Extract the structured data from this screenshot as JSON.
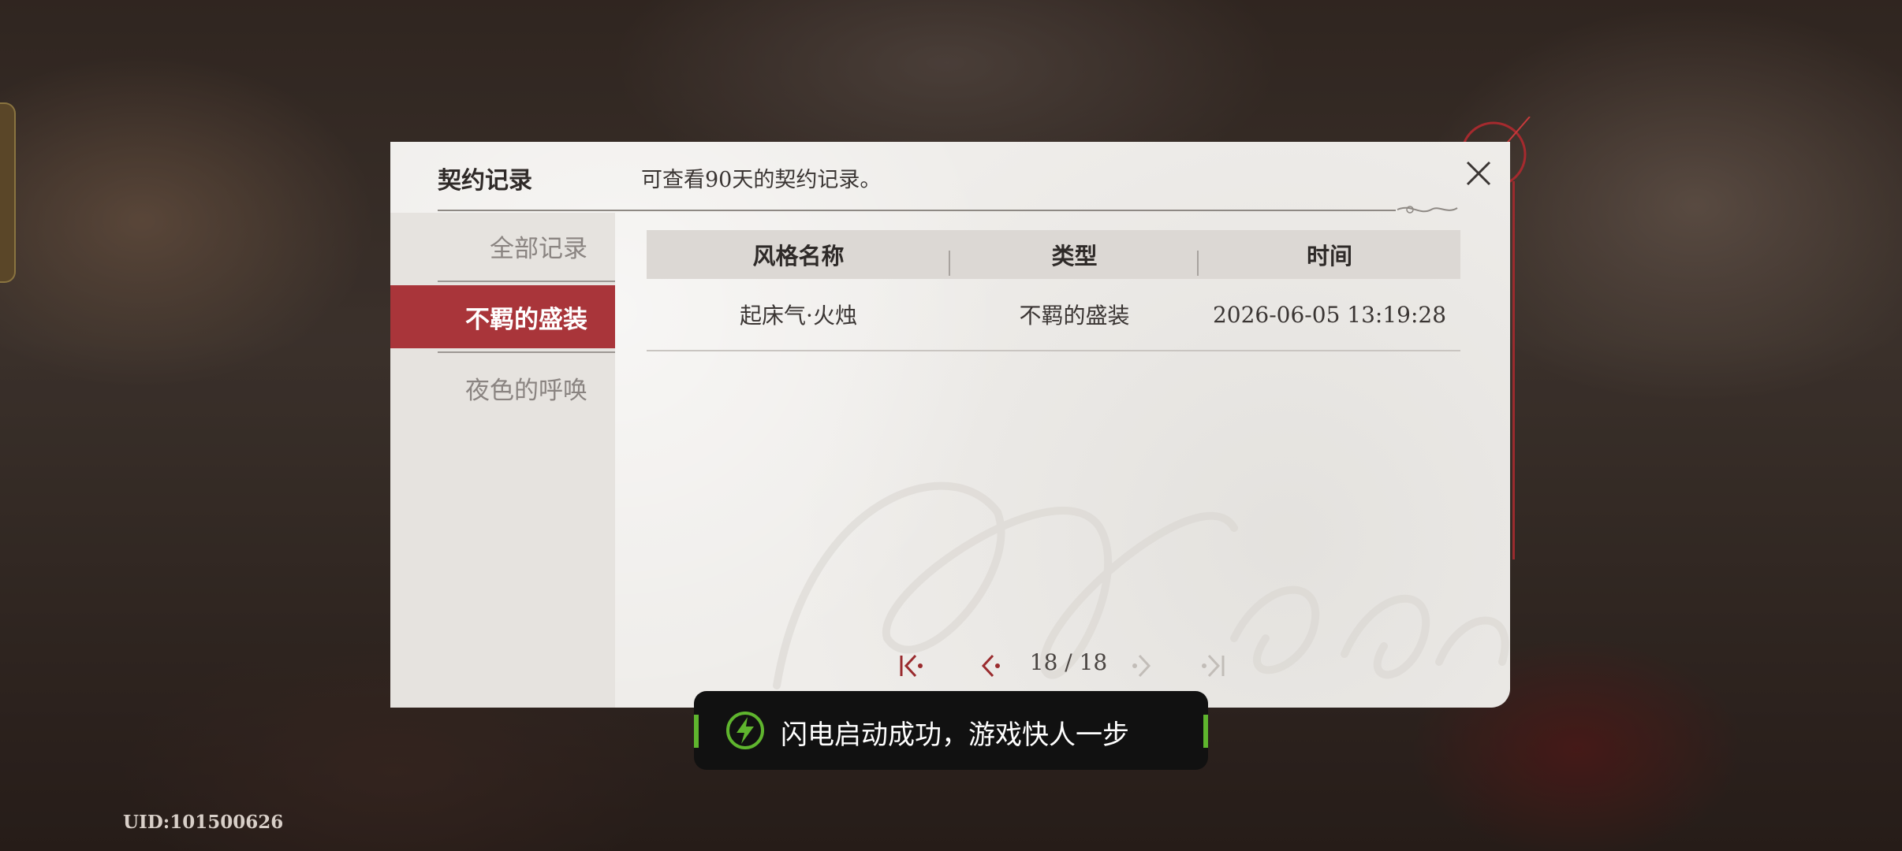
{
  "header": {
    "title": "契约记录",
    "subtitle": "可查看90天的契约记录。"
  },
  "sidebar": {
    "items": [
      {
        "label": "全部记录",
        "active": false
      },
      {
        "label": "不羁的盛装",
        "active": true
      },
      {
        "label": "夜色的呼唤",
        "active": false
      }
    ]
  },
  "table": {
    "columns": [
      "风格名称",
      "类型",
      "时间"
    ],
    "rows": [
      {
        "name": "起床气·火烛",
        "type": "不羁的盛装",
        "time": "2026-06-05 13:19:28"
      }
    ]
  },
  "pagination": {
    "current": "18",
    "total": "18",
    "label": "18 / 18"
  },
  "toast": {
    "text": "闪电启动成功，游戏快人一步"
  },
  "uid": "UID:101500626",
  "colors": {
    "accent_red": "#a9353a",
    "toast_green": "#5fb52e"
  }
}
